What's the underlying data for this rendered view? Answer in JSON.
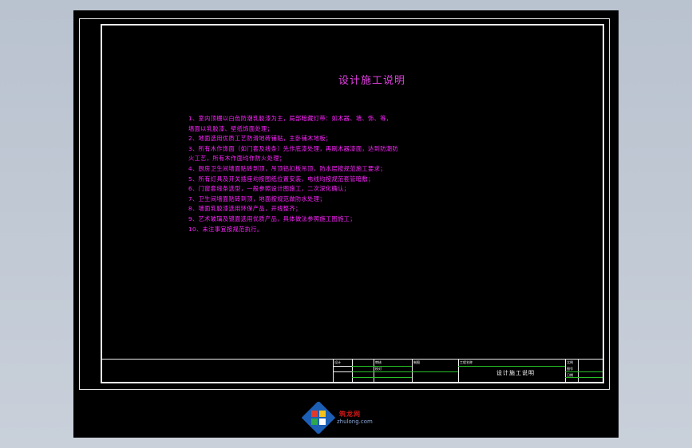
{
  "document": {
    "title": "设计施工说明",
    "notes": [
      "1、室内顶棚以白色防潮乳胶漆为主，局部暗藏灯带：如木器、墙、饰、等，",
      "墙面以乳胶漆、壁纸饰面处理；",
      "2、地面选用优质工艺防滑地砖铺贴，主卧铺木地板；",
      "3、所有木作饰面（如门套及线条）先作底漆处理，再刷木器漆面，达到防潮防",
      "火工艺，所有木作面均作防火处理；",
      "4、厨房卫生间墙面贴砖到顶，吊顶铝扣板吊顶，防水层按规范施工要求；",
      "5、所有灯具及开关插座均按图纸位置安装，电线均按规范套管暗敷；",
      "6、门窗套线条选型，一般参照设计图施工，二次深化确认；",
      "7、卫生间墙面贴砖到顶，地面按规范做防水处理；",
      "8、墙面乳胶漆选用环保产品，开线整齐；",
      "9、艺术玻璃及镜面选用优质产品，具体做法参照施工图施工；",
      "10、未注事宜按规范执行。"
    ]
  },
  "title_block": {
    "drawing_name": "设计施工说明",
    "tick_labels": [
      "设计",
      "审核",
      "校对",
      "制图",
      "比例",
      "图号",
      "日期",
      "工程名称"
    ]
  },
  "logo": {
    "brand": "筑龙网",
    "site": "zhulong.com"
  }
}
